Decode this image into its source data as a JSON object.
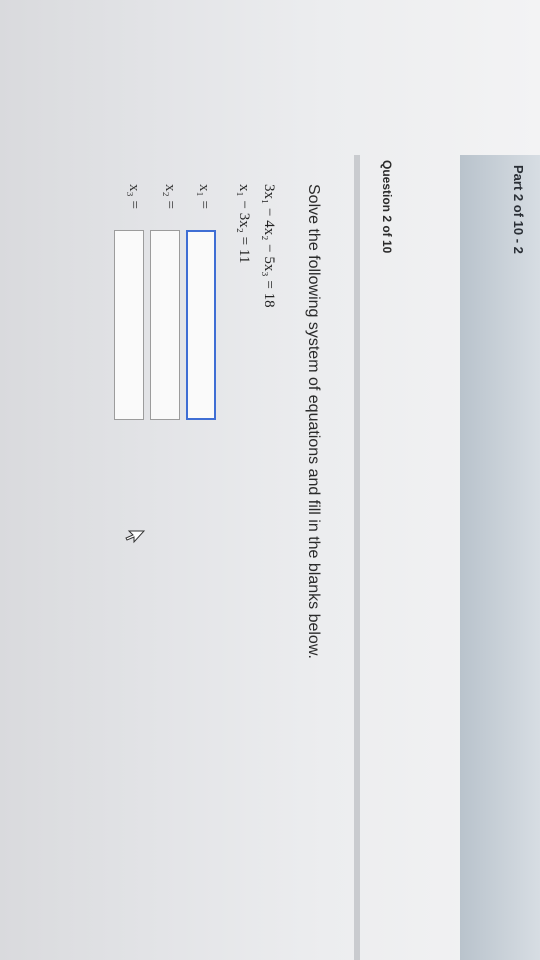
{
  "header": {
    "part_title": "Part 2 of 10 - 2"
  },
  "question": {
    "label": "Question 2 of 10",
    "instruction": "Solve the following system of equations and fill in the blanks below.",
    "equation_1": "3x₁ − 4x₂ − 5x₃ = 18",
    "equation_2": "x₁ − 3x₂ = 11"
  },
  "answers": [
    {
      "label": "x₁ =",
      "value": ""
    },
    {
      "label": "x₂ =",
      "value": ""
    },
    {
      "label": "x₃ =",
      "value": ""
    }
  ],
  "colors": {
    "header_bar": "#c3ccd4",
    "focused_input_border": "#3f6ed4"
  },
  "icons": {
    "pointer": "mouse-cursor-icon"
  }
}
